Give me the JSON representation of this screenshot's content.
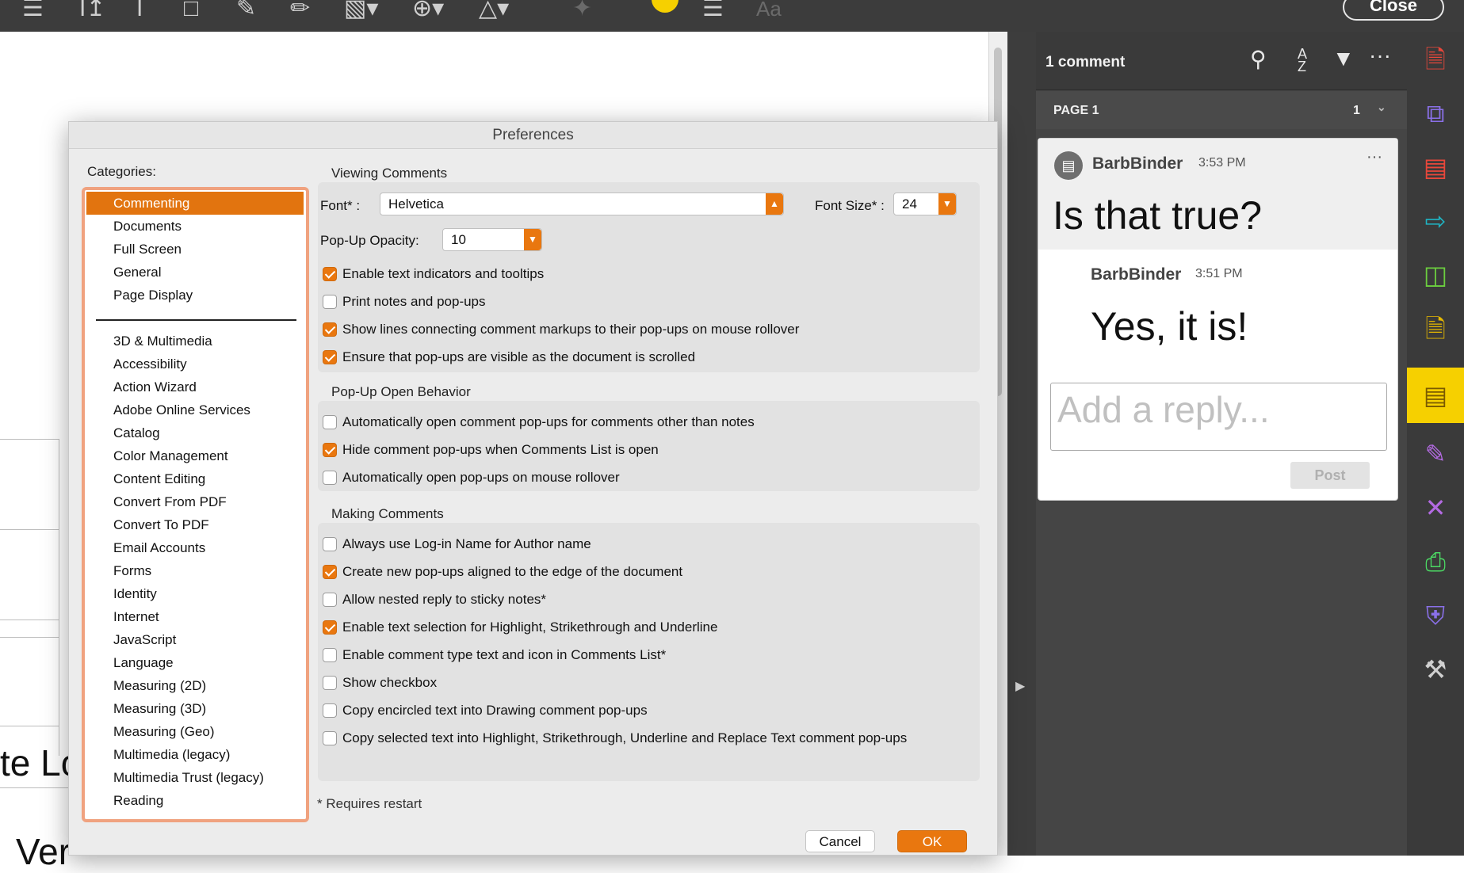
{
  "toolbar": {
    "close_label": "Close",
    "font_icon": "Aa"
  },
  "document": {
    "fragment1": "te Lo",
    "fragment2": "Ver"
  },
  "comments_panel": {
    "count_label": "1 comment",
    "page_label": "PAGE 1",
    "page_count": "1",
    "comment": {
      "author": "BarbBinder",
      "time": "3:53 PM",
      "text": "Is that true?"
    },
    "reply": {
      "author": "BarbBinder",
      "time": "3:51 PM",
      "text": "Yes, it is!"
    },
    "reply_placeholder": "Add a reply...",
    "post_label": "Post"
  },
  "preferences": {
    "title": "Preferences",
    "categories_label": "Categories:",
    "categories_top": [
      "Commenting",
      "Documents",
      "Full Screen",
      "General",
      "Page Display"
    ],
    "categories": [
      "3D & Multimedia",
      "Accessibility",
      "Action Wizard",
      "Adobe Online Services",
      "Catalog",
      "Color Management",
      "Content Editing",
      "Convert From PDF",
      "Convert To PDF",
      "Email Accounts",
      "Forms",
      "Identity",
      "Internet",
      "JavaScript",
      "Language",
      "Measuring (2D)",
      "Measuring (3D)",
      "Measuring (Geo)",
      "Multimedia (legacy)",
      "Multimedia Trust (legacy)",
      "Reading"
    ],
    "viewing": {
      "title": "Viewing Comments",
      "font_label": "Font* :",
      "font_value": "Helvetica",
      "font_size_label": "Font Size* :",
      "font_size_value": "24",
      "opacity_label": "Pop-Up Opacity:",
      "opacity_value": "10",
      "options": [
        {
          "label": "Enable text indicators and tooltips",
          "checked": true
        },
        {
          "label": "Print notes and pop-ups",
          "checked": false
        },
        {
          "label": "Show lines connecting comment markups to their pop-ups on mouse rollover",
          "checked": true
        },
        {
          "label": "Ensure that pop-ups are visible as the document is scrolled",
          "checked": true
        }
      ]
    },
    "popup": {
      "title": "Pop-Up Open Behavior",
      "options": [
        {
          "label": "Automatically open comment pop-ups for comments other than notes",
          "checked": false
        },
        {
          "label": "Hide comment pop-ups when Comments List is open",
          "checked": true
        },
        {
          "label": "Automatically open pop-ups on mouse rollover",
          "checked": false
        }
      ]
    },
    "making": {
      "title": "Making Comments",
      "options": [
        {
          "label": "Always use Log-in Name for Author name",
          "checked": false
        },
        {
          "label": "Create new pop-ups aligned to the edge of the document",
          "checked": true
        },
        {
          "label": "Allow nested reply to sticky notes*",
          "checked": false
        },
        {
          "label": "Enable text selection for Highlight, Strikethrough and Underline",
          "checked": true
        },
        {
          "label": "Enable comment type text and icon in Comments List*",
          "checked": false
        },
        {
          "label": "Show checkbox",
          "checked": false
        },
        {
          "label": "Copy encircled text into Drawing comment pop-ups",
          "checked": false
        },
        {
          "label": "Copy selected text into Highlight, Strikethrough, Underline and Replace Text comment pop-ups",
          "checked": false
        }
      ]
    },
    "requires_restart": "* Requires restart",
    "cancel_label": "Cancel",
    "ok_label": "OK"
  },
  "colors": {
    "accent": "#e9770f",
    "comment_active": "#f6d000",
    "dark_panel": "#3c3c3c"
  }
}
